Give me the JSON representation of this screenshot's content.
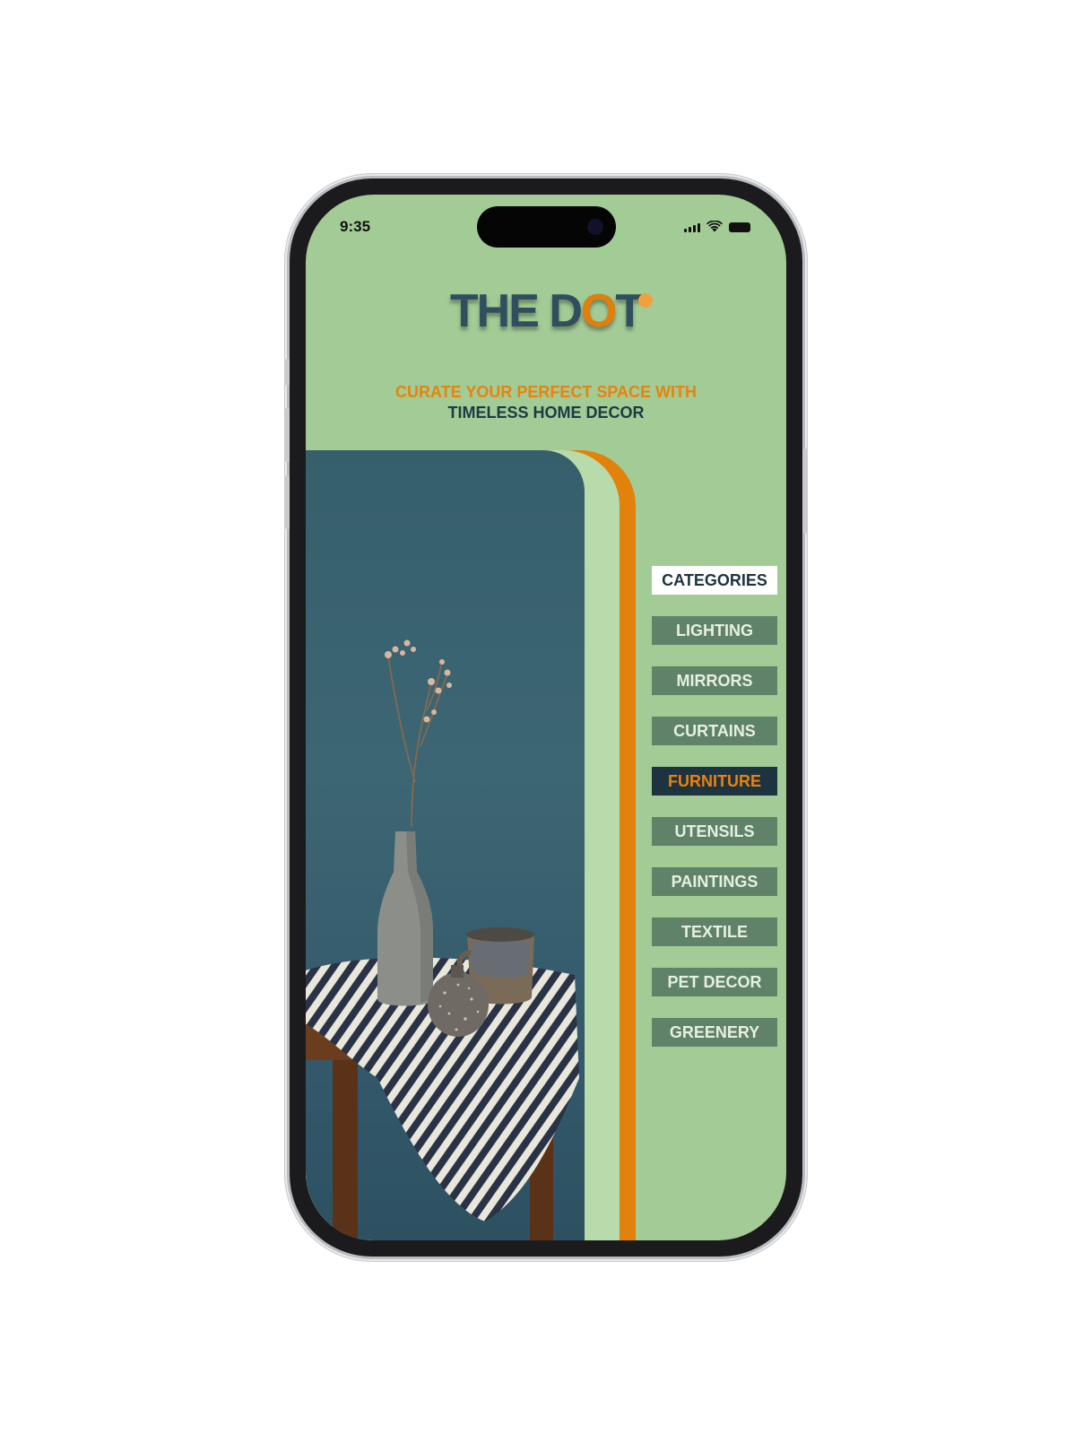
{
  "status_bar": {
    "time": "9:35"
  },
  "brand": {
    "logo_prefix": "THE D",
    "logo_o": "O",
    "logo_suffix": "T",
    "tagline_line1": "CURATE YOUR PERFECT SPACE WITH",
    "tagline_line2": "TIMELESS HOME DECOR"
  },
  "categories": {
    "header": "CATEGORIES",
    "items": [
      {
        "label": "LIGHTING",
        "active": false
      },
      {
        "label": "MIRRORS",
        "active": false
      },
      {
        "label": "CURTAINS",
        "active": false
      },
      {
        "label": "FURNITURE",
        "active": true
      },
      {
        "label": "UTENSILS",
        "active": false
      },
      {
        "label": "PAINTINGS",
        "active": false
      },
      {
        "label": "TEXTILE",
        "active": false
      },
      {
        "label": "PET DECOR",
        "active": false
      },
      {
        "label": "GREENERY",
        "active": false
      }
    ]
  },
  "colors": {
    "background": "#a3cb95",
    "accent_orange": "#e2810b",
    "dark_navy": "#1e3340",
    "category_chip": "#5f8269",
    "wall_teal": "#3d6674"
  }
}
